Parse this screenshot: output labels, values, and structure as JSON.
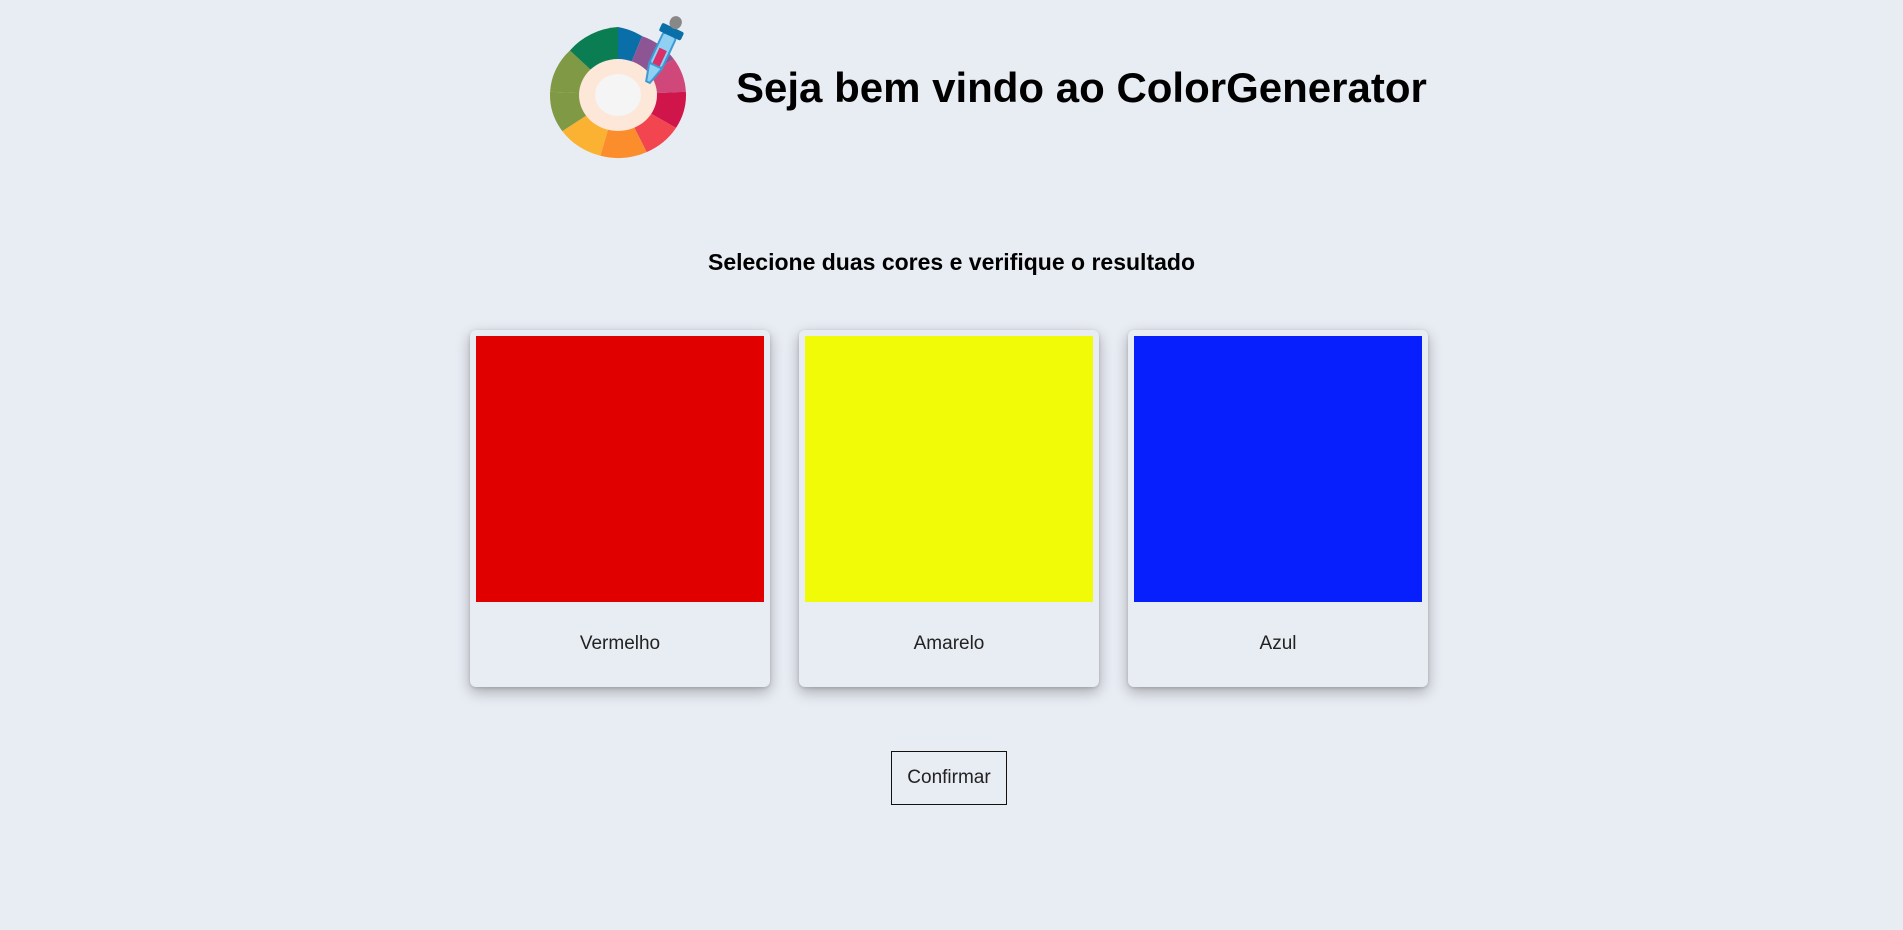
{
  "header": {
    "logo_icon": "color-wheel-eyedropper-icon",
    "title": "Seja bem vindo ao ColorGenerator"
  },
  "instructions": "Selecione duas cores e verifique o resultado",
  "colors": [
    {
      "label": "Vermelho",
      "hex": "#e00000"
    },
    {
      "label": "Amarelo",
      "hex": "#f2fb07"
    },
    {
      "label": "Azul",
      "hex": "#071ffd"
    }
  ],
  "confirm_label": "Confirmar"
}
